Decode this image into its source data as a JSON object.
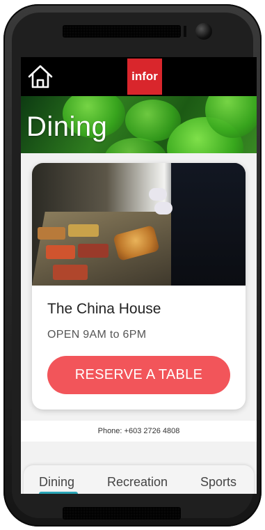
{
  "header": {
    "logo_text": "infor",
    "home_icon": "home-icon"
  },
  "hero": {
    "title": "Dining"
  },
  "venue": {
    "name": "The China House",
    "hours": "OPEN 9AM to 6PM",
    "reserve_label": "RESERVE A TABLE"
  },
  "contact": {
    "phone": "Phone: +603 2726 4808"
  },
  "tabs": [
    {
      "label": "Dining",
      "active": true
    },
    {
      "label": "Recreation",
      "active": false
    },
    {
      "label": "Sports",
      "active": false
    }
  ],
  "colors": {
    "brand_red": "#d9262c",
    "button": "#f2555a",
    "tab_indicator": "#2aa5b6",
    "topbar": "#000000"
  }
}
